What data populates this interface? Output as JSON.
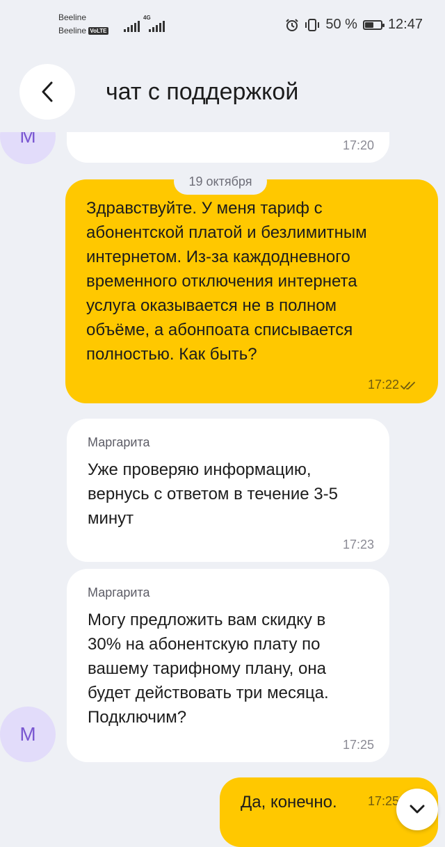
{
  "status_bar": {
    "carrier_1": "Beeline",
    "carrier_2": "Beeline",
    "volte": "VoLTE",
    "net_type": "4G",
    "battery_percent": "50 %",
    "battery_level": 0.5,
    "time": "12:47",
    "icons": [
      "alarm-icon",
      "vibrate-icon",
      "battery-icon",
      "signal-icon"
    ]
  },
  "header": {
    "title": "чат с поддержкой",
    "back_icon": "chevron-left-icon"
  },
  "chat": {
    "avatar_letter": "М",
    "date_separator": "19 октября",
    "messages": [
      {
        "direction": "in",
        "sender": "",
        "text": "",
        "time": "17:20"
      },
      {
        "direction": "out",
        "text": "Здравствуйте. У меня тариф с\nабонентской платой и безлимитным\nинтернетом. Из-за каждодневного\nвременного отключения интернета\nуслуга оказывается не в полном\nобъёме, а абонпоата списывается\nполностью. Как быть?",
        "time": "17:22",
        "status": "read"
      },
      {
        "direction": "in",
        "sender": "Маргарита",
        "text": "Уже проверяю информацию,\nвернусь с ответом в течение 3-5\nминут",
        "time": "17:23"
      },
      {
        "direction": "in",
        "sender": "Маргарита",
        "text": "Могу предложить вам скидку в\n30% на абонентскую плату по\nвашему тарифному плану, она\nбудет действовать три месяца.\nПодключим?",
        "time": "17:25"
      },
      {
        "direction": "out",
        "text": "Да, конечно.",
        "time": "17:25"
      }
    ]
  },
  "scroll_down_icon": "chevron-down-icon",
  "colors": {
    "background": "#eef0f5",
    "outgoing_bubble": "#ffc800",
    "incoming_bubble": "#ffffff",
    "avatar_bg": "#e2dcfa",
    "avatar_text": "#7a57d1"
  }
}
